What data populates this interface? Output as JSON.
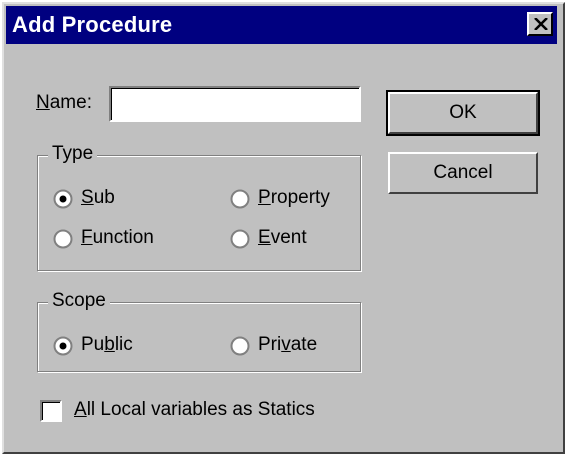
{
  "window": {
    "title": "Add Procedure",
    "close_icon": "close-icon"
  },
  "name_field": {
    "label_mnemonic": "N",
    "label_rest": "ame:",
    "value": ""
  },
  "buttons": {
    "ok": "OK",
    "cancel": "Cancel"
  },
  "type_group": {
    "legend": "Type",
    "options": [
      {
        "pre": "",
        "mn": "S",
        "post": "ub",
        "selected": true
      },
      {
        "pre": "",
        "mn": "P",
        "post": "roperty",
        "selected": false
      },
      {
        "pre": "",
        "mn": "F",
        "post": "unction",
        "selected": false
      },
      {
        "pre": "",
        "mn": "E",
        "post": "vent",
        "selected": false
      }
    ]
  },
  "scope_group": {
    "legend": "Scope",
    "options": [
      {
        "pre": "Pu",
        "mn": "b",
        "post": "lic",
        "selected": true
      },
      {
        "pre": "Pri",
        "mn": "v",
        "post": "ate",
        "selected": false
      }
    ]
  },
  "statics_checkbox": {
    "mn": "A",
    "post": "ll Local variables as Statics",
    "checked": false
  }
}
